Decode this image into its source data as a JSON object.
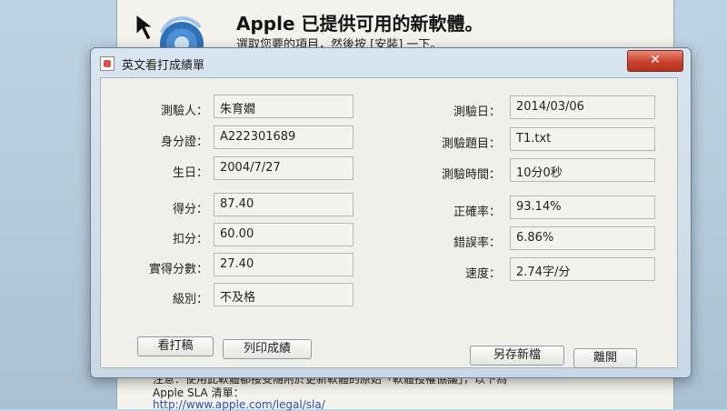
{
  "background_window": {
    "title": "Apple 已提供可用的新軟體。",
    "subtitle": "選取您要的項目，然後按 [安裝] 一下。",
    "notice": "注意：使用此軟體都接受隨附於更新軟體的原始「軟體授權協議」，以下為",
    "sla_label": "Apple SLA 清單：",
    "link": "http://www.apple.com/legal/sla/"
  },
  "dialog": {
    "title": "英文看打成績單",
    "close_label": "✕",
    "left_fields": [
      {
        "label": "測驗人：",
        "value": "朱育嫺"
      },
      {
        "label": "身分證：",
        "value": "A222301689"
      },
      {
        "label": "生日：",
        "value": "2004/7/27"
      },
      {
        "label": "得分：",
        "value": "87.40"
      },
      {
        "label": "扣分：",
        "value": "60.00"
      },
      {
        "label": "實得分數：",
        "value": "27.40"
      },
      {
        "label": "級別：",
        "value": "不及格"
      }
    ],
    "right_fields": [
      {
        "label": "測驗日：",
        "value": "2014/03/06"
      },
      {
        "label": "測驗題目：",
        "value": "T1.txt"
      },
      {
        "label": "測驗時間：",
        "value": "10分0秒"
      },
      {
        "label": "正確率：",
        "value": "93.14%"
      },
      {
        "label": "錯誤率：",
        "value": "6.86%"
      },
      {
        "label": "速度：",
        "value": "2.74字/分"
      }
    ],
    "buttons": {
      "view_draft": "看打稿",
      "print_score": "列印成績",
      "save_new": "另存新檔",
      "leave": "離開"
    }
  }
}
